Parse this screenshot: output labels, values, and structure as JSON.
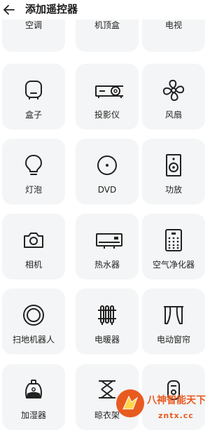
{
  "header": {
    "back_icon": "arrow-left-icon",
    "title": "添加遥控器"
  },
  "devices": [
    {
      "label": "空调",
      "icon": "air-conditioner-icon"
    },
    {
      "label": "机顶盒",
      "icon": "set-top-box-icon"
    },
    {
      "label": "电视",
      "icon": "tv-icon"
    },
    {
      "label": "盒子",
      "icon": "tv-box-icon"
    },
    {
      "label": "投影仪",
      "icon": "projector-icon"
    },
    {
      "label": "风扇",
      "icon": "fan-icon"
    },
    {
      "label": "灯泡",
      "icon": "light-bulb-icon"
    },
    {
      "label": "DVD",
      "icon": "dvd-icon"
    },
    {
      "label": "功放",
      "icon": "speaker-icon"
    },
    {
      "label": "相机",
      "icon": "camera-icon"
    },
    {
      "label": "热水器",
      "icon": "water-heater-icon"
    },
    {
      "label": "空气净化器",
      "icon": "air-purifier-icon"
    },
    {
      "label": "扫地机器人",
      "icon": "robot-vacuum-icon"
    },
    {
      "label": "电暖器",
      "icon": "electric-heater-icon"
    },
    {
      "label": "电动窗帘",
      "icon": "curtain-icon"
    },
    {
      "label": "加湿器",
      "icon": "humidifier-icon"
    },
    {
      "label": "晾衣架",
      "icon": "clothes-rack-icon"
    },
    {
      "label": "",
      "icon": "smart-device-icon"
    }
  ],
  "watermark": {
    "name": "八神智能天下",
    "url": "zntx.cc",
    "color": "#e85b20"
  }
}
